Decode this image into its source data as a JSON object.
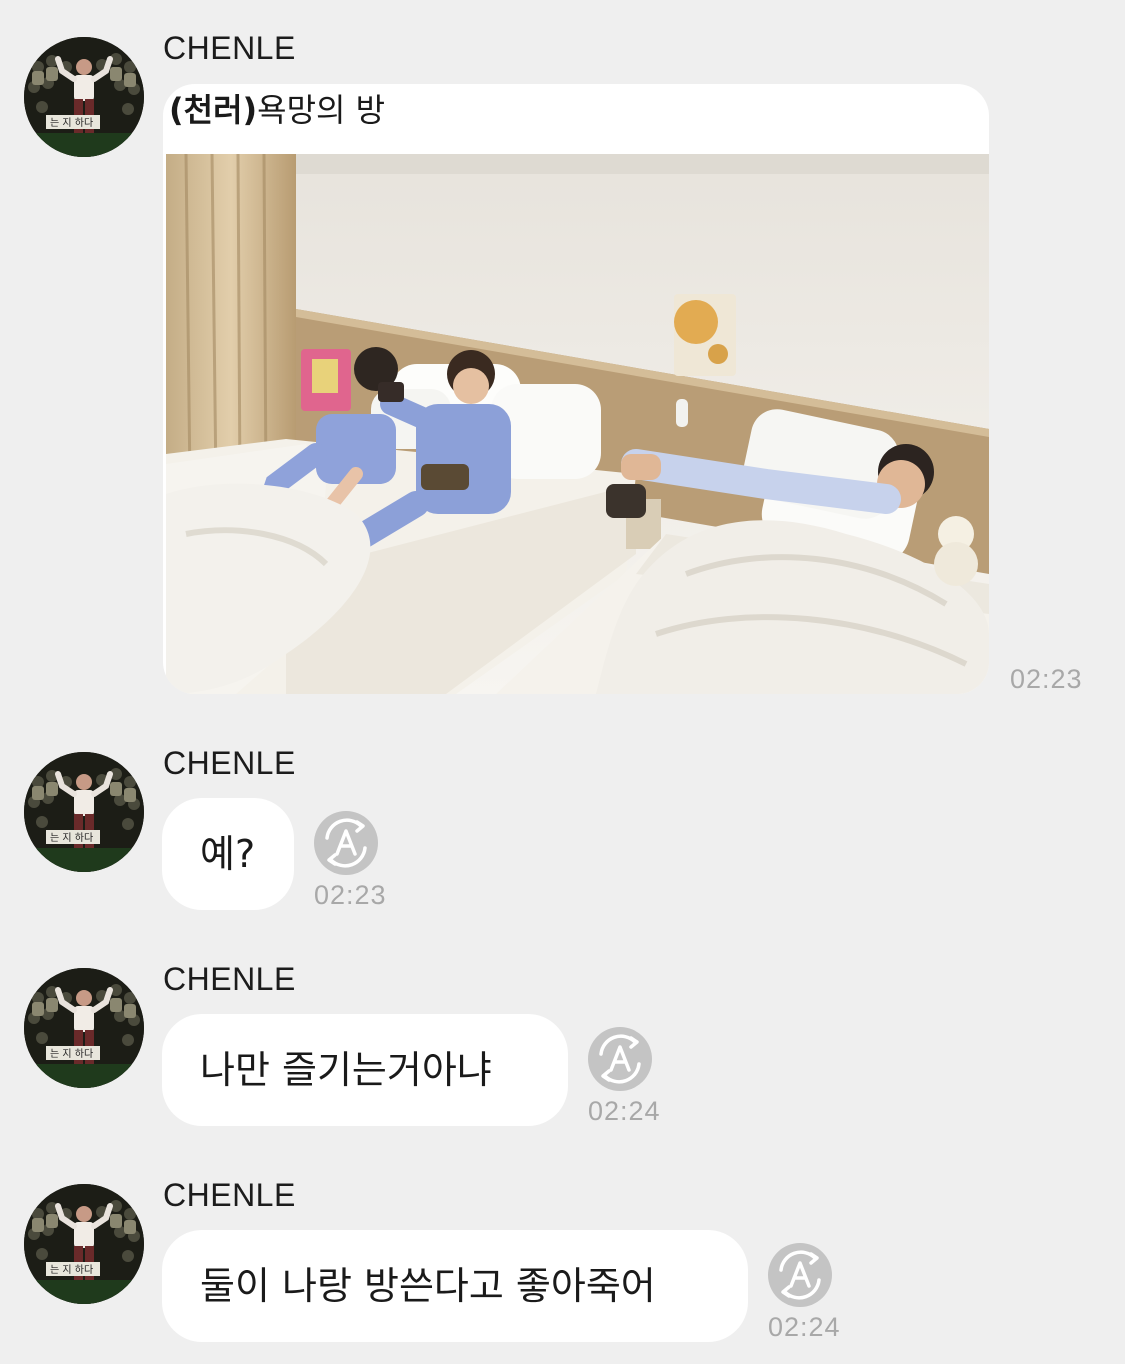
{
  "messages": [
    {
      "sender": "CHENLE",
      "type": "image",
      "caption_bold": "(천러)",
      "caption_rest": "욕망의 방",
      "time": "02:23"
    },
    {
      "sender": "CHENLE",
      "type": "text",
      "text": "예?",
      "time": "02:23",
      "translate_icon": "translate-icon"
    },
    {
      "sender": "CHENLE",
      "type": "text",
      "text": "나만 즐기는거아냐",
      "time": "02:24",
      "translate_icon": "translate-icon"
    },
    {
      "sender": "CHENLE",
      "type": "text",
      "text": "둘이 나랑 방쓴다고 좋아죽어",
      "time": "02:24",
      "translate_icon": "translate-icon"
    }
  ],
  "colors": {
    "background": "#efefef",
    "bubble": "#ffffff",
    "timestamp": "#a8a8a8",
    "translate_icon": "#c4c4c4"
  }
}
